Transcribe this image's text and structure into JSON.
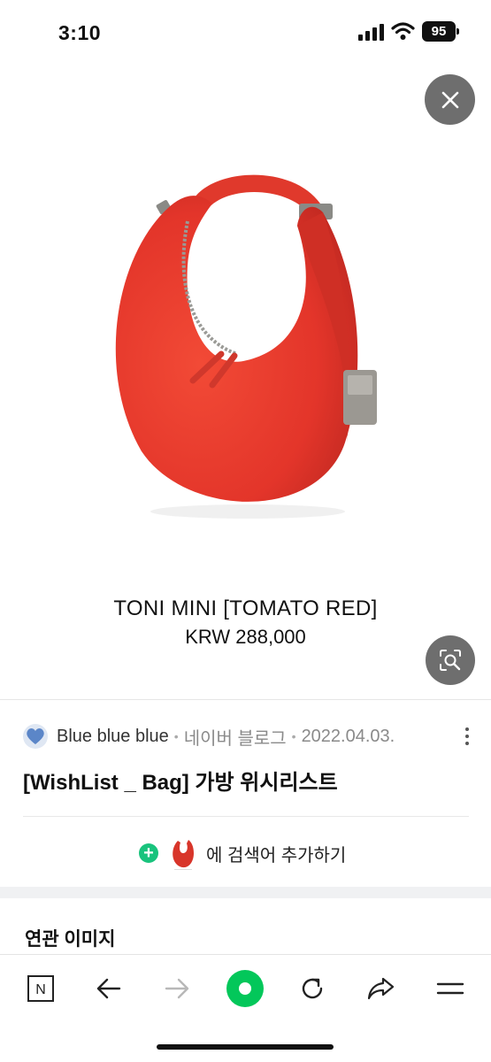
{
  "status_bar": {
    "time": "3:10",
    "battery": "95"
  },
  "product": {
    "name": "TONI MINI [TOMATO RED]",
    "price": "KRW 288,000"
  },
  "source": {
    "name": "Blue blue blue",
    "type": "네이버 블로그",
    "date": "2022.04.03.",
    "separator": "•"
  },
  "post": {
    "title": "[WishList _ Bag] 가방 위시리스트"
  },
  "add_search": {
    "label": "에 검색어 추가하기"
  },
  "related": {
    "title": "연관 이미지"
  },
  "toolbar": {
    "home_letter": "N"
  },
  "colors": {
    "bag_red": "#e8392c",
    "naver_green": "#03c75a",
    "add_green": "#19c37d",
    "overlay_gray": "#6e6e6e"
  },
  "icons": [
    "signal-icon",
    "wifi-icon",
    "battery-icon",
    "close-icon",
    "lens-search-icon",
    "heart-avatar-icon",
    "more-icon",
    "plus-icon",
    "naver-home-icon",
    "back-arrow-icon",
    "forward-arrow-icon",
    "green-dot-icon",
    "refresh-icon",
    "share-icon",
    "menu-icon"
  ]
}
